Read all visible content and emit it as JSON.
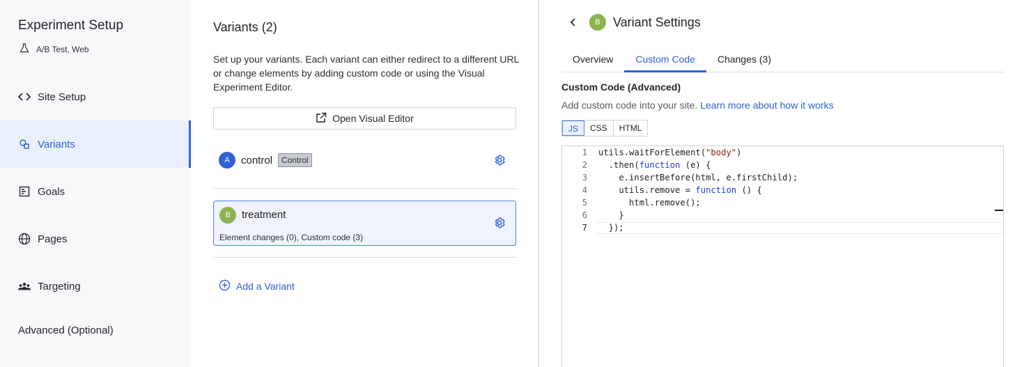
{
  "sidebar": {
    "title": "Experiment Setup",
    "subtitle": "A/B Test, Web",
    "items": [
      {
        "label": "Site Setup",
        "icon": "code-icon"
      },
      {
        "label": "Variants",
        "icon": "variants-icon",
        "active": true
      },
      {
        "label": "Goals",
        "icon": "goals-icon"
      },
      {
        "label": "Pages",
        "icon": "globe-icon"
      },
      {
        "label": "Targeting",
        "icon": "people-icon"
      },
      {
        "label": "Advanced (Optional)"
      }
    ]
  },
  "variants": {
    "title": "Variants (2)",
    "description": "Set up your variants. Each variant can either redirect to a different URL or change elements by adding custom code or using the Visual Experiment Editor.",
    "open_editor_label": "Open Visual Editor",
    "list": [
      {
        "letter": "A",
        "name": "control",
        "tag": "Control"
      },
      {
        "letter": "B",
        "name": "treatment",
        "detail": "Element changes (0), Custom code (3)"
      }
    ],
    "add_label": "Add a Variant"
  },
  "settings": {
    "title": "Variant Settings",
    "letter": "B",
    "tabs": [
      {
        "label": "Overview"
      },
      {
        "label": "Custom Code",
        "active": true
      },
      {
        "label": "Changes (3)"
      }
    ],
    "section_title": "Custom Code (Advanced)",
    "section_desc": "Add custom code into your site.",
    "learn_more": "Learn more about how it works",
    "languages": [
      "JS",
      "CSS",
      "HTML"
    ],
    "active_language": "JS",
    "line_numbers": [
      "1",
      "2",
      "3",
      "4",
      "5",
      "6",
      "7"
    ]
  },
  "colors": {
    "accent": "#2f60d6",
    "variant_a": "#2f60d6",
    "variant_b": "#8bb352"
  }
}
